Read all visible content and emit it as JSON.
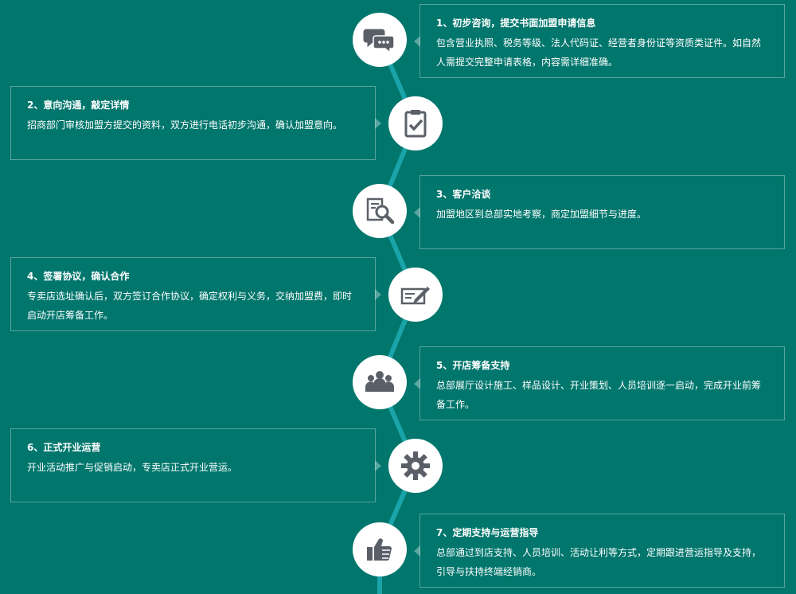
{
  "colors": {
    "background": "#00766c",
    "connector": "#1aa3a8",
    "icon": "#5b6068",
    "card_border": "rgba(255,255,255,0.35)"
  },
  "steps": [
    {
      "title": "1、初步咨询，提交书面加盟申请信息",
      "desc": "包含营业执照、税务等级、法人代码证、经营者身份证等资质类证件。如自然人需提交完整申请表格，内容需详细准确。",
      "icon": "chat-bubbles-icon"
    },
    {
      "title": "2、意向沟通，敲定详情",
      "desc": "招商部门审核加盟方提交的资料，双方进行电话初步沟通，确认加盟意向。",
      "icon": "clipboard-check-icon"
    },
    {
      "title": "3、客户洽谈",
      "desc": "加盟地区到总部实地考察，商定加盟细节与进度。",
      "icon": "magnifier-doc-icon"
    },
    {
      "title": "4、签署协议，确认合作",
      "desc": "专卖店选址确认后，双方签订合作协议，确定权利与义务，交纳加盟费，即时启动开店筹备工作。",
      "icon": "sign-contract-icon"
    },
    {
      "title": "5、开店筹备支持",
      "desc": "总部展厅设计施工、样品设计、开业策划、人员培训逐一启动，完成开业前筹备工作。",
      "icon": "team-icon"
    },
    {
      "title": "6、正式开业运营",
      "desc": "开业活动推广与促销启动，专卖店正式开业营运。",
      "icon": "gear-icon"
    },
    {
      "title": "7、定期支持与运营指导",
      "desc": "总部通过到店支持、人员培训、活动让利等方式，定期跟进营运指导及支持，引导与扶持终端经销商。",
      "icon": "thumbs-up-icon"
    }
  ]
}
